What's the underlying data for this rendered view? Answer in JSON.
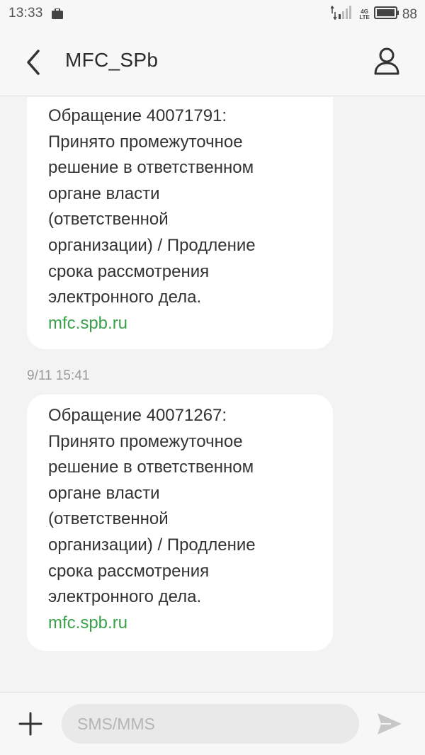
{
  "status_bar": {
    "time": "13:33",
    "network_top": "4G",
    "network_bottom": "LTE",
    "battery_level": "88",
    "icons": [
      "briefcase-icon",
      "signal-icon",
      "battery-icon"
    ]
  },
  "header": {
    "title": "MFC_SPb",
    "icons": [
      "back-arrow-icon",
      "contact-icon"
    ]
  },
  "messages": [
    {
      "text": "Обращение 40071791:\nПринято промежуточное\nрешение в ответственном\nоргане власти\n(ответственной\nорганизации) / Продление\nсрока рассмотрения\nэлектронного дела.",
      "link": "mfc.spb.ru"
    },
    {
      "timestamp": "9/11 15:41",
      "text": "Обращение 40071267:\nПринято промежуточное\nрешение в ответственном\nоргане власти\n(ответственной\nорганизации) / Продление\nсрока рассмотрения\nэлектронного дела.",
      "link": "mfc.spb.ru"
    }
  ],
  "composer": {
    "placeholder": "SMS/MMS",
    "value": "",
    "icons": [
      "plus-icon",
      "send-icon"
    ]
  },
  "colors": {
    "background": "#f3f3f3",
    "bubble": "#ffffff",
    "link": "#3aa14a",
    "text": "#333333",
    "muted": "#9a9a9a"
  }
}
